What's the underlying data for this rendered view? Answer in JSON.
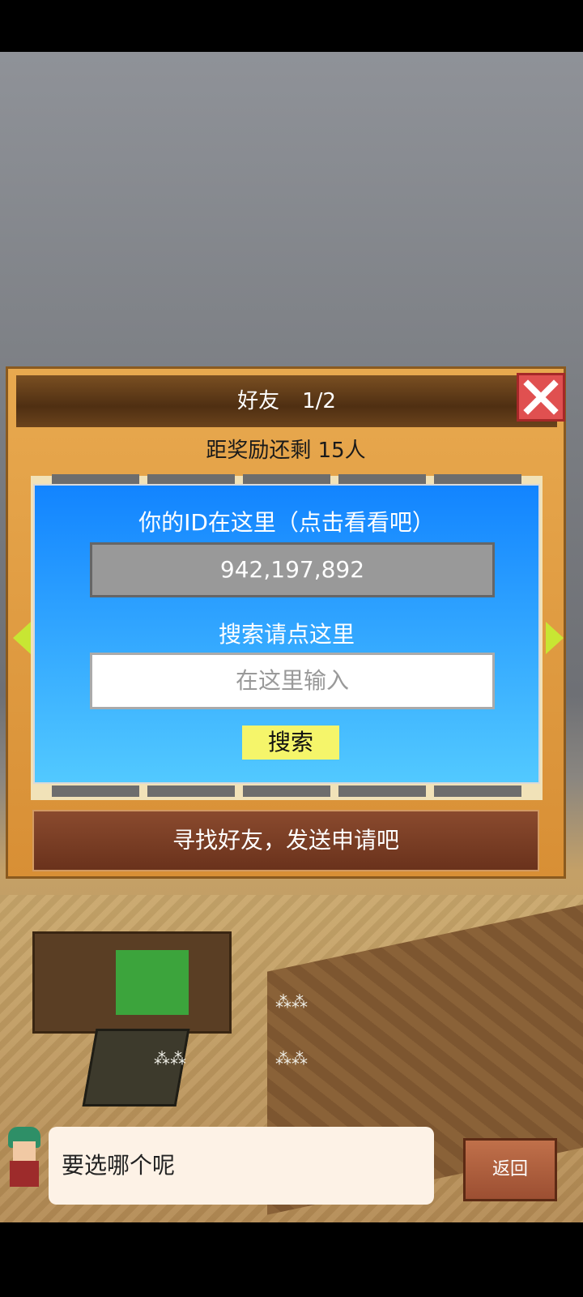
{
  "dialog": {
    "title": "好友",
    "page": "1/2",
    "reward_text": "距奖励还剩 15人"
  },
  "id_panel": {
    "title": "你的ID在这里（点击看看吧）",
    "id_value": "942,197,892",
    "search_label": "搜索请点这里",
    "search_placeholder": "在这里输入",
    "search_button": "搜索"
  },
  "find_button": "寻找好友，发送申请吧",
  "chat": {
    "message": "要选哪个呢"
  },
  "back_button": "返回",
  "colors": {
    "close_red": "#e05050",
    "panel_blue": "#1284ff",
    "search_yellow": "#f5f56a",
    "nav_arrow": "#c8e633"
  },
  "icons": [
    "close-icon",
    "arrow-left-icon",
    "arrow-right-icon"
  ]
}
